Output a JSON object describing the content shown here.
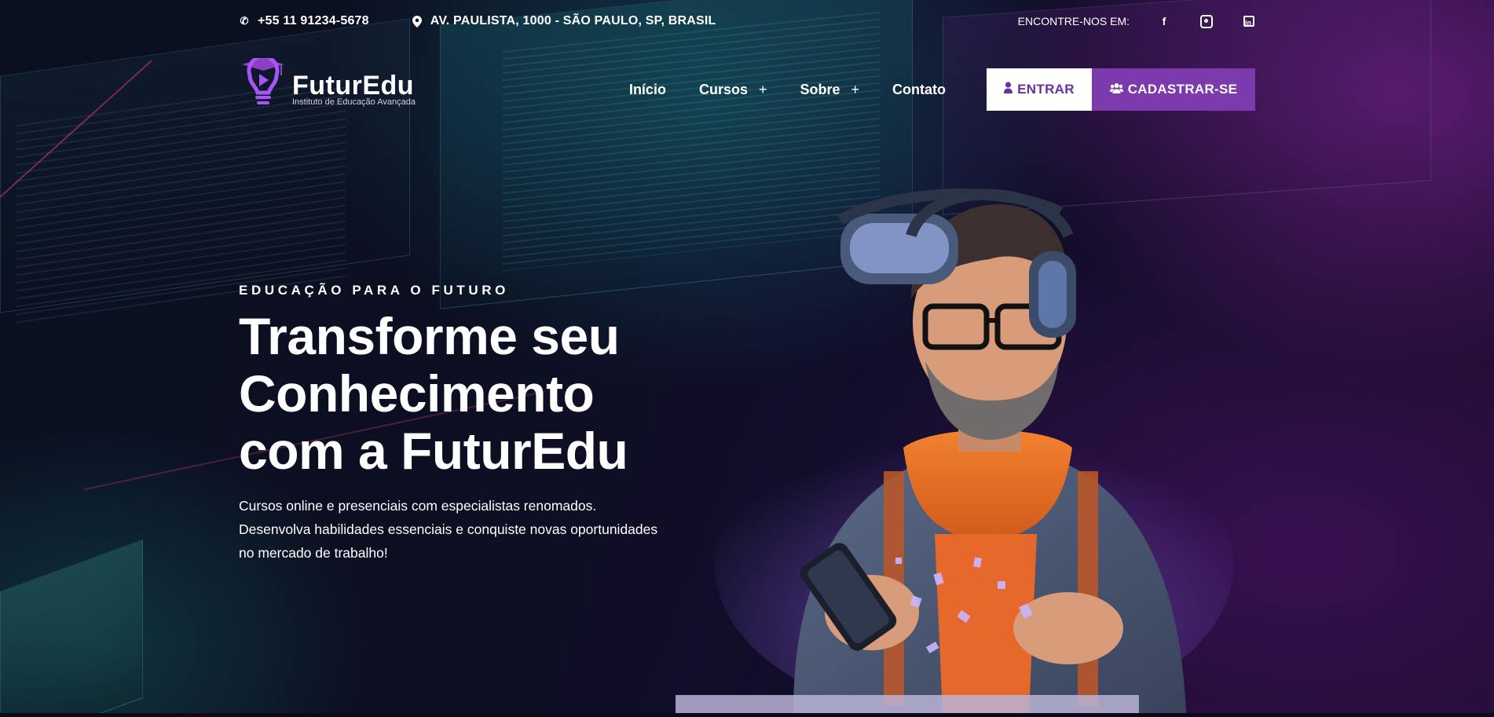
{
  "topbar": {
    "phone": "+55 11 91234-5678",
    "address": "AV. PAULISTA, 1000 - SÃO PAULO, SP, BRASIL",
    "social_label": "ENCONTRE-NOS EM:",
    "social_icons": [
      "facebook-icon",
      "instagram-icon",
      "linkedin-icon"
    ]
  },
  "logo": {
    "brand": "FuturEdu",
    "tagline": "Instituto de Educação Avançada"
  },
  "nav": {
    "items": [
      {
        "label": "Início",
        "has_submenu": false
      },
      {
        "label": "Cursos",
        "has_submenu": true
      },
      {
        "label": "Sobre",
        "has_submenu": true
      },
      {
        "label": "Contato",
        "has_submenu": false
      }
    ],
    "submenu_symbol": "+"
  },
  "buttons": {
    "login": "ENTRAR",
    "signup": "CADASTRAR-SE"
  },
  "hero": {
    "eyebrow": "EDUCAÇÃO PARA O FUTURO",
    "title_line1": "Transforme seu",
    "title_line2": "Conhecimento",
    "title_line3": "com a FuturEdu",
    "description": "Cursos online e presenciais com especialistas renomados. Desenvolva habilidades essenciais e conquiste novas oportunidades no mercado de trabalho!"
  },
  "colors": {
    "accent": "#7c3aad",
    "accent_light": "#a855f7",
    "background": "#0b0a1c",
    "text": "#ffffff"
  }
}
